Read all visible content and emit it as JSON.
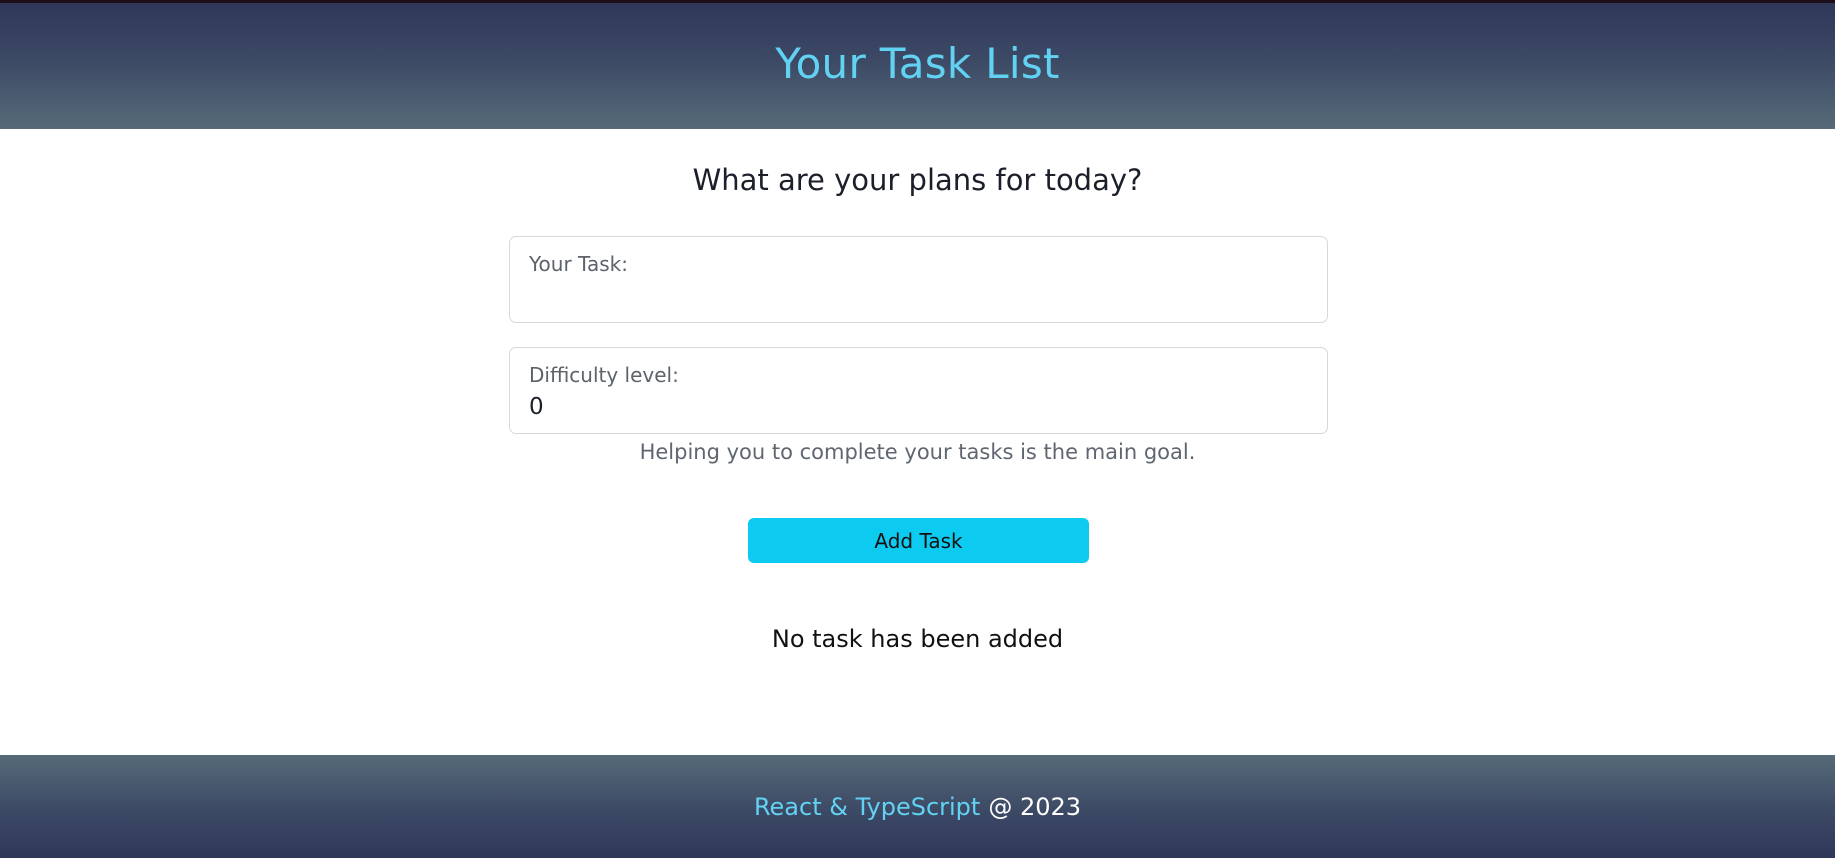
{
  "header": {
    "title": "Your Task List"
  },
  "main": {
    "heading": "What are your plans for today?",
    "task_field": {
      "label": "Your Task:",
      "value": "",
      "placeholder": ""
    },
    "difficulty_field": {
      "label": "Difficulty level:",
      "value": "0"
    },
    "helper_text": "Helping you to complete your tasks is the main goal.",
    "add_button_label": "Add Task",
    "empty_message": "No task has been added"
  },
  "footer": {
    "tech_label": "React & TypeScript",
    "year_text": "@ 2023"
  },
  "colors": {
    "accent": "#62d2f3",
    "button": "#0dcaf0",
    "header_dark": "#2f3758",
    "header_light": "#566a78"
  }
}
